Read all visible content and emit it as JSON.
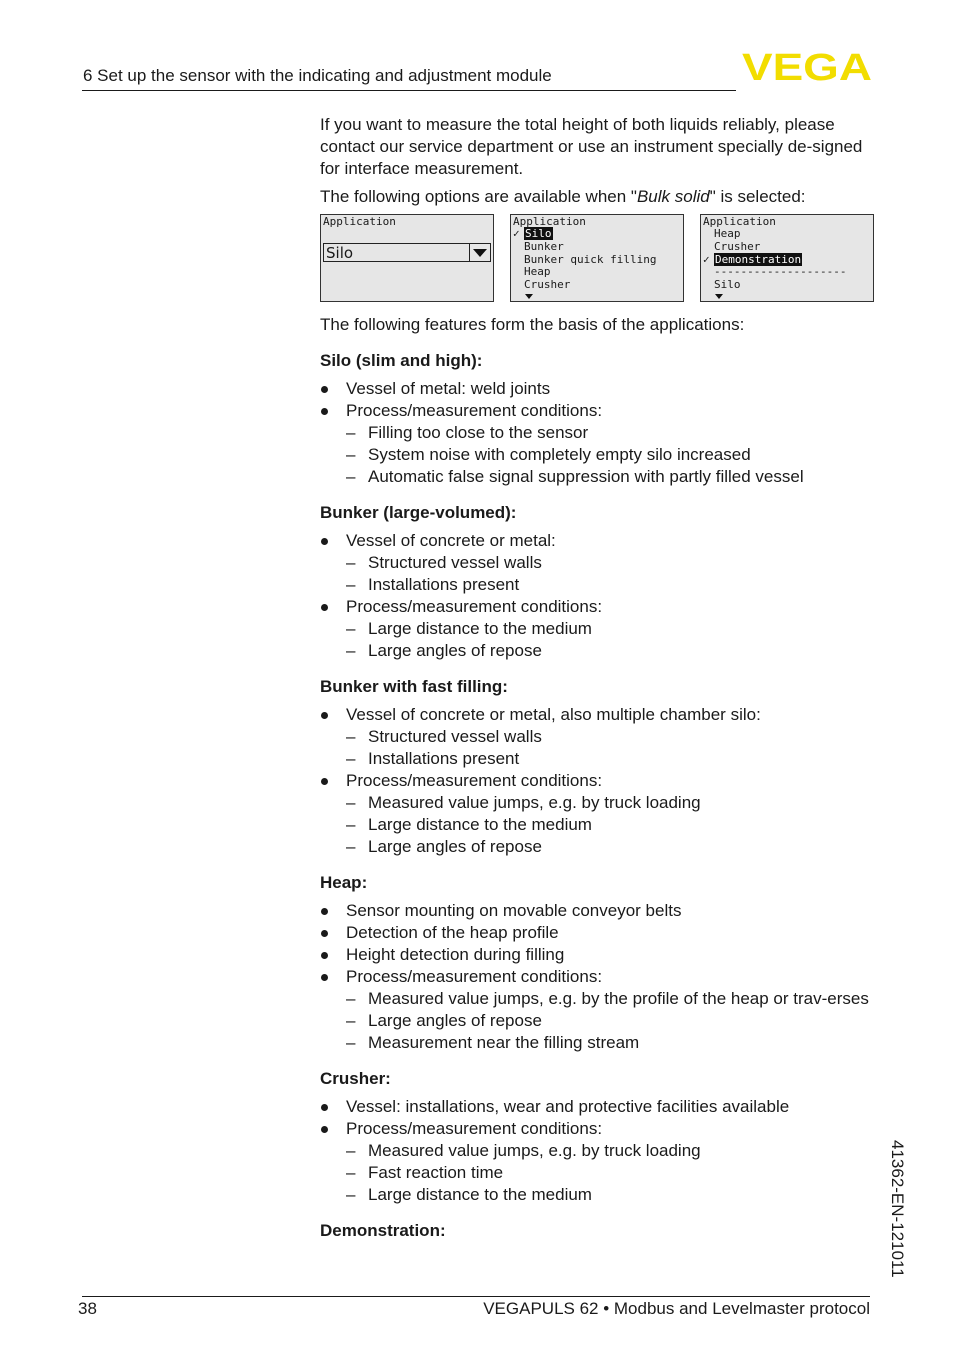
{
  "header": {
    "section_title": "6 Set up the sensor with the indicating and adjustment module",
    "logo_text": "VEGA",
    "logo_color": "#f2dd00"
  },
  "intro": {
    "paragraph": "If you want to measure the total height of both liquids reliably, please contact our service department or use an instrument specially de-signed for interface measurement.",
    "options_prefix": "The following options are available when \"",
    "options_italic": "Bulk solid",
    "options_suffix": "\" is selected:"
  },
  "screens": [
    {
      "title": "Application",
      "selected_value": "Silo"
    },
    {
      "title": "Application",
      "items": [
        "Silo",
        "Bunker",
        "Bunker quick filling",
        "Heap",
        "Crusher"
      ],
      "checked": "Silo"
    },
    {
      "title": "Application",
      "items": [
        "Heap",
        "Crusher",
        "Demonstration",
        "--------------------",
        "Silo"
      ],
      "checked": "Demonstration"
    }
  ],
  "features_intro": "The following features form the basis of the applications:",
  "sections": [
    {
      "heading": "Silo (slim and high):",
      "bullets": [
        {
          "text": "Vessel of metal: weld joints",
          "sub": []
        },
        {
          "text": "Process/measurement conditions:",
          "sub": [
            "Filling too close to the sensor",
            "System noise with completely empty silo increased",
            "Automatic false signal suppression with partly filled vessel"
          ]
        }
      ]
    },
    {
      "heading": "Bunker (large-volumed):",
      "bullets": [
        {
          "text": "Vessel of concrete or metal:",
          "sub": [
            "Structured vessel walls",
            "Installations present"
          ]
        },
        {
          "text": "Process/measurement conditions:",
          "sub": [
            "Large distance to the medium",
            "Large angles of repose"
          ]
        }
      ]
    },
    {
      "heading": "Bunker with fast filling:",
      "bullets": [
        {
          "text": "Vessel of concrete or metal, also multiple chamber silo:",
          "sub": [
            "Structured vessel walls",
            "Installations present"
          ]
        },
        {
          "text": "Process/measurement conditions:",
          "sub": [
            "Measured value jumps, e.g. by truck loading",
            "Large distance to the medium",
            "Large angles of repose"
          ]
        }
      ]
    },
    {
      "heading": "Heap:",
      "bullets": [
        {
          "text": "Sensor mounting on movable conveyor belts",
          "sub": []
        },
        {
          "text": "Detection of the heap profile",
          "sub": []
        },
        {
          "text": "Height detection during filling",
          "sub": []
        },
        {
          "text": "Process/measurement conditions:",
          "sub": [
            "Measured value jumps, e.g. by the profile of the heap or trav-erses",
            "Large angles of repose",
            "Measurement near the filling stream"
          ]
        }
      ]
    },
    {
      "heading": "Crusher:",
      "bullets": [
        {
          "text": "Vessel: installations, wear and protective facilities available",
          "sub": []
        },
        {
          "text": "Process/measurement conditions:",
          "sub": [
            "Measured value jumps, e.g. by truck loading",
            "Fast reaction time",
            "Large distance to the medium"
          ]
        }
      ]
    },
    {
      "heading": "Demonstration:",
      "bullets": []
    }
  ],
  "footer": {
    "page_number": "38",
    "doc_title": "VEGAPULS 62 • Modbus and Levelmaster protocol",
    "side_code": "41362-EN-121011"
  }
}
